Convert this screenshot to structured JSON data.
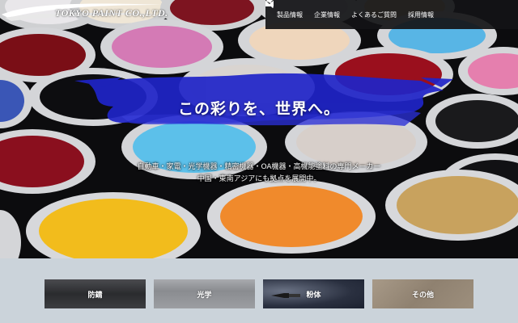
{
  "brand": {
    "logo_text": "TOKYO PAINT CO.,LTD."
  },
  "nav": {
    "items": [
      "製品情報",
      "企業情報",
      "よくあるご質問",
      "採用情報"
    ],
    "mail_icon": "mail-icon",
    "search_icon": "search-icon"
  },
  "hero": {
    "headline": "この彩りを、世界へ。",
    "sub_line1": "自動車・家電・光学機器・精密機器・OA機器・高機能塗料の専門メーカー",
    "sub_line2": "中国・東南アジアにも拠点を展開中。"
  },
  "categories": [
    {
      "label": "防錆"
    },
    {
      "label": "光学"
    },
    {
      "label": "粉体"
    },
    {
      "label": "その他"
    }
  ],
  "colors": {
    "brush_blue": "#1f24c8",
    "footer_bg": "#cbd3da"
  }
}
